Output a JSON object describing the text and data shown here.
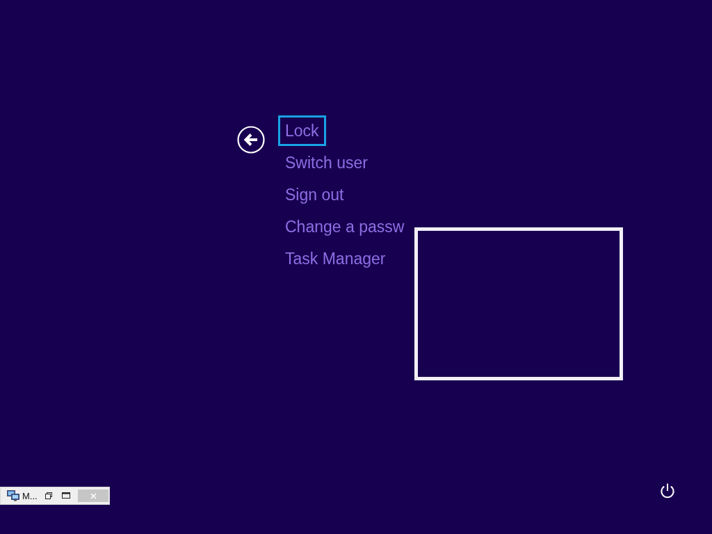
{
  "menu": {
    "items": [
      {
        "label": "Lock",
        "selected": true
      },
      {
        "label": "Switch user",
        "selected": false
      },
      {
        "label": "Sign out",
        "selected": false
      },
      {
        "label": "Change a passw",
        "selected": false
      },
      {
        "label": "Task Manager",
        "selected": false
      }
    ]
  },
  "minimized_window": {
    "title": "M..."
  }
}
